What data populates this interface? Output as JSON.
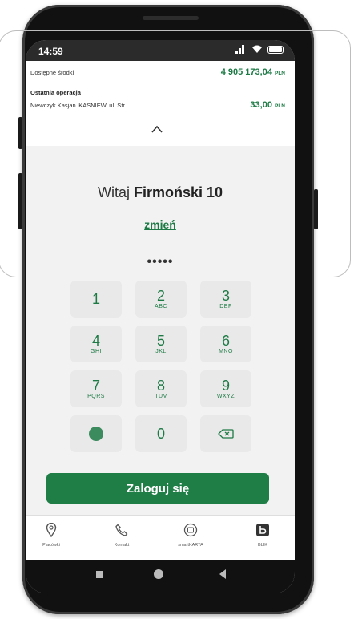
{
  "status": {
    "time": "14:59"
  },
  "account": {
    "available_label": "Dostępne środki",
    "balance": "4 905 173,04",
    "balance_currency": "PLN",
    "last_op_label": "Ostatnia operacja",
    "last_op_desc": "Niewczyk Kasjan 'KASNIEW' ul. Str...",
    "last_op_amount": "33,00",
    "last_op_currency": "PLN"
  },
  "welcome": {
    "greeting": "Witaj",
    "name": "Firmoński 10",
    "change": "zmień"
  },
  "pin_dots": "•••••",
  "keypad": [
    {
      "digit": "1",
      "letters": ""
    },
    {
      "digit": "2",
      "letters": "ABC"
    },
    {
      "digit": "3",
      "letters": "DEF"
    },
    {
      "digit": "4",
      "letters": "GHI"
    },
    {
      "digit": "5",
      "letters": "JKL"
    },
    {
      "digit": "6",
      "letters": "MNO"
    },
    {
      "digit": "7",
      "letters": "PQRS"
    },
    {
      "digit": "8",
      "letters": "TUV"
    },
    {
      "digit": "9",
      "letters": "WXYZ"
    },
    {
      "digit": "0",
      "letters": ""
    }
  ],
  "login_label": "Zaloguj się",
  "tabs": [
    {
      "label": "Placówki",
      "icon": "location-pin-icon"
    },
    {
      "label": "Kontakt",
      "icon": "phone-icon"
    },
    {
      "label": "smartKARTA",
      "icon": "smart-card-icon"
    },
    {
      "label": "BLIK",
      "icon": "blik-icon"
    }
  ],
  "colors": {
    "brand_green": "#1d7a45",
    "button_green": "#1f7d46"
  }
}
